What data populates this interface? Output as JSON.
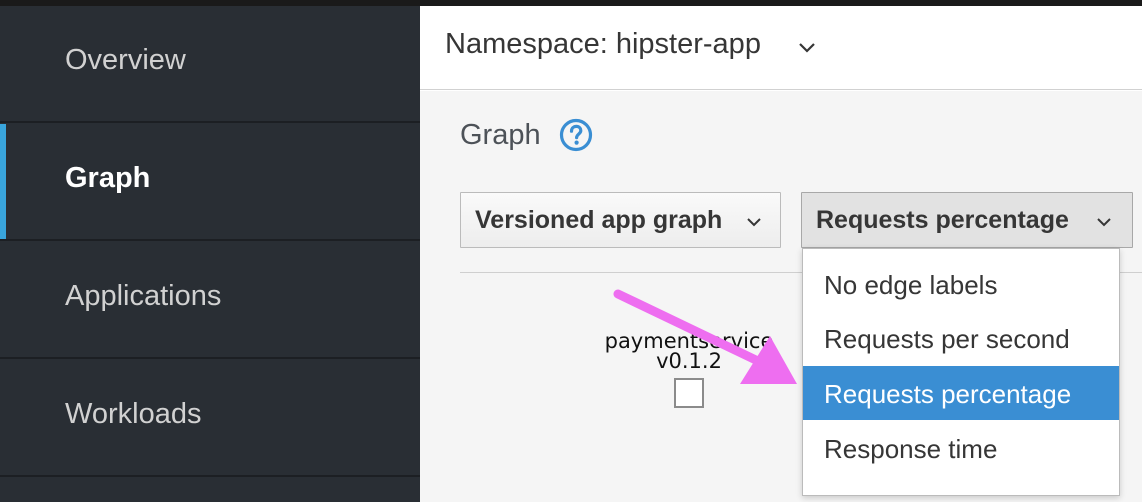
{
  "sidebar": {
    "items": [
      {
        "label": "Overview"
      },
      {
        "label": "Graph"
      },
      {
        "label": "Applications"
      },
      {
        "label": "Workloads"
      }
    ],
    "active": "Graph"
  },
  "namespace": {
    "label": "Namespace: hipster-app"
  },
  "page": {
    "title": "Graph"
  },
  "toolbar": {
    "graph_type": "Versioned app graph",
    "edge_labels": "Requests percentage"
  },
  "edge_label_menu": {
    "options": [
      {
        "label": "No edge labels"
      },
      {
        "label": "Requests per second"
      },
      {
        "label": "Requests percentage"
      },
      {
        "label": "Response time"
      }
    ],
    "selected": "Requests percentage"
  },
  "graph": {
    "node_name": "paymentservice",
    "node_version": "v0.1.2"
  },
  "colors": {
    "sidebar_bg": "#292e34",
    "active_indicator": "#39a5dc",
    "selected_option": "#3a8ed3",
    "help_icon": "#3a8ed3",
    "annotation_arrow": "#ee6ef0"
  },
  "icons": [
    "chevron-down-icon",
    "help-icon",
    "annotation-arrow"
  ]
}
